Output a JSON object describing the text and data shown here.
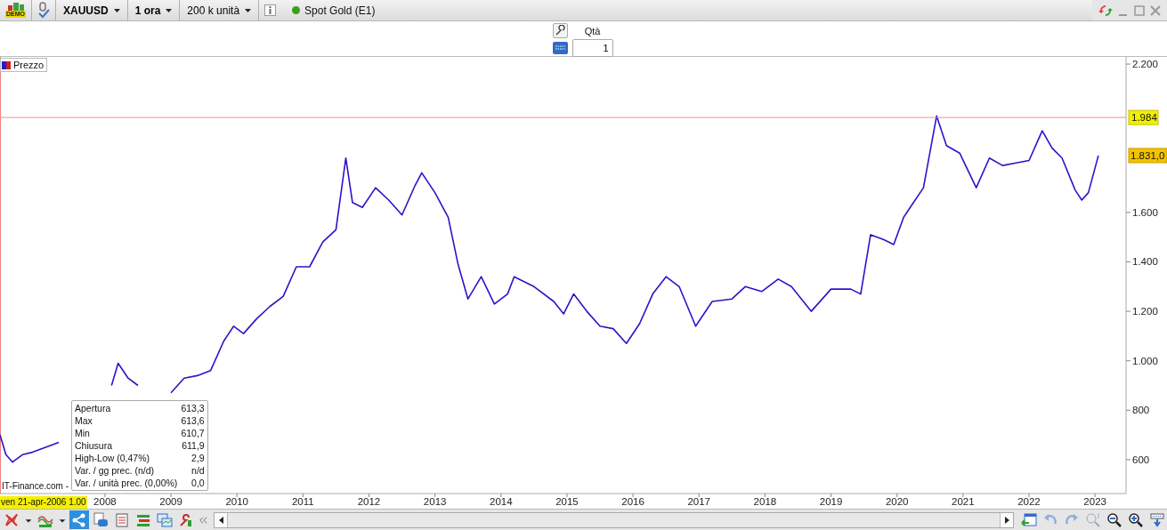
{
  "toolbar": {
    "account_badge": "DEMO",
    "symbol": "XAUUSD",
    "timeframe": "1 ora",
    "units": "200 k unità",
    "instrument": "Spot Gold (E1)"
  },
  "order_panel": {
    "quantity_label": "Qtà",
    "quantity_value": "1"
  },
  "chart": {
    "source_text": "IT-Finance.com -",
    "crosshair_date": "ven 21-apr-2006 1.00",
    "tooltip": [
      {
        "label": "Apertura",
        "value": "613,3"
      },
      {
        "label": "Max",
        "value": "613,6"
      },
      {
        "label": "Min",
        "value": "610,7"
      },
      {
        "label": "Chiusura",
        "value": "611,9"
      },
      {
        "label": "High-Low (0,47%)",
        "value": "2,9"
      },
      {
        "label": "Var. / gg prec. (n/d)",
        "value": "n/d"
      },
      {
        "label": "Var. / unità prec. (0,00%)",
        "value": "0,0"
      }
    ],
    "chart_data": {
      "type": "line",
      "xlim": [
        2006.41,
        2023.47
      ],
      "ylim": [
        463,
        2229
      ],
      "x": [
        2006.41,
        2006.5,
        2006.6,
        2006.75,
        2006.9,
        2007.1,
        2007.3,
        2008.1,
        2008.2,
        2008.35,
        2008.5,
        2009.0,
        2009.2,
        2009.4,
        2009.6,
        2009.8,
        2009.95,
        2010.1,
        2010.3,
        2010.5,
        2010.7,
        2010.9,
        2011.1,
        2011.3,
        2011.5,
        2011.65,
        2011.75,
        2011.9,
        2012.1,
        2012.3,
        2012.5,
        2012.7,
        2012.8,
        2013.0,
        2013.2,
        2013.35,
        2013.5,
        2013.7,
        2013.9,
        2014.1,
        2014.2,
        2014.5,
        2014.8,
        2014.95,
        2015.1,
        2015.3,
        2015.5,
        2015.7,
        2015.9,
        2016.1,
        2016.3,
        2016.5,
        2016.7,
        2016.95,
        2017.2,
        2017.5,
        2017.7,
        2017.95,
        2018.2,
        2018.4,
        2018.7,
        2019.0,
        2019.3,
        2019.45,
        2019.6,
        2019.8,
        2019.95,
        2020.1,
        2020.2,
        2020.4,
        2020.6,
        2020.75,
        2020.95,
        2021.2,
        2021.4,
        2021.6,
        2021.8,
        2022.0,
        2022.2,
        2022.35,
        2022.5,
        2022.7,
        2022.8,
        2022.9,
        2023.05
      ],
      "yticks": [
        600,
        800,
        {
          "value": 1000,
          "label": "1.000"
        },
        {
          "value": 1200,
          "label": "1.200"
        },
        {
          "value": 1400,
          "label": "1.400"
        },
        {
          "value": 1600,
          "label": "1.600"
        },
        {
          "value": 2200,
          "label": "2.200"
        }
      ],
      "xticks": [
        2008,
        2009,
        2010,
        2011,
        2012,
        2013,
        2014,
        2015,
        2016,
        2017,
        2018,
        2019,
        2020,
        2021,
        2022,
        2023
      ],
      "series": [
        {
          "name": "Prezzo",
          "color": "#2a14c8",
          "values": [
            700,
            620,
            590,
            620,
            630,
            650,
            670,
            900,
            990,
            930,
            900,
            870,
            930,
            940,
            960,
            1080,
            1140,
            1110,
            1170,
            1220,
            1260,
            1380,
            1380,
            1480,
            1530,
            1820,
            1640,
            1620,
            1700,
            1650,
            1590,
            1710,
            1760,
            1680,
            1580,
            1390,
            1250,
            1340,
            1230,
            1270,
            1340,
            1300,
            1240,
            1190,
            1270,
            1200,
            1140,
            1130,
            1070,
            1150,
            1270,
            1340,
            1300,
            1140,
            1240,
            1250,
            1300,
            1280,
            1330,
            1300,
            1200,
            1290,
            1290,
            1270,
            1510,
            1490,
            1470,
            1580,
            1620,
            1700,
            1990,
            1870,
            1840,
            1700,
            1820,
            1790,
            1800,
            1810,
            1930,
            1860,
            1820,
            1690,
            1650,
            1680,
            1830
          ]
        }
      ],
      "ref_lines": [
        {
          "axis": "y",
          "value": 1984,
          "label": "1.984"
        }
      ],
      "annotations": [
        "1.831,0"
      ]
    }
  }
}
